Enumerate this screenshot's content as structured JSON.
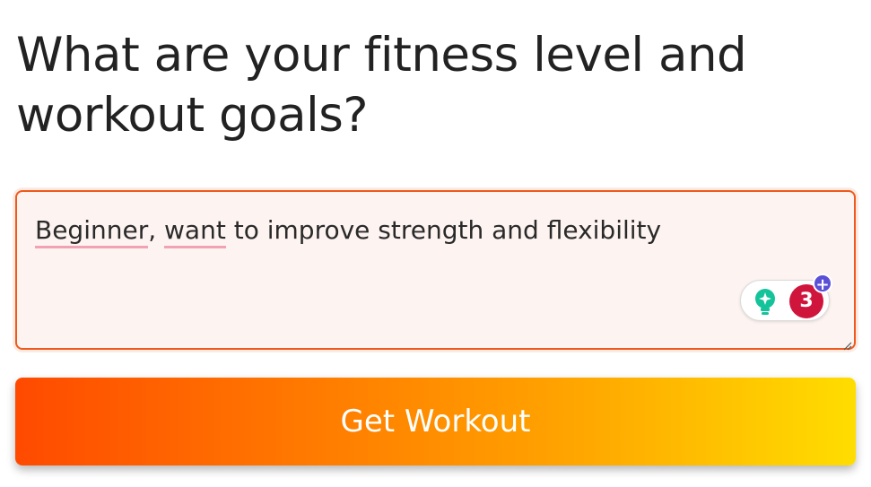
{
  "heading": {
    "text": "What are your fitness level and workout goals?"
  },
  "goals_input": {
    "value_parts": [
      "Beginner",
      ",",
      " ",
      "want",
      " to improve strength and flexibility"
    ],
    "value": "Beginner, want to improve strength and flexibility",
    "spell_flagged_words": [
      "Beginner",
      "want"
    ],
    "border_color": "#ee5a1c",
    "background_color": "#fdf3f1"
  },
  "grammarly": {
    "suggestion_count": "3",
    "plus_symbol": "+",
    "icons": [
      "lightbulb-icon",
      "plus-icon"
    ],
    "badge_color": "#d0153c",
    "bulb_color": "#15c39a",
    "plus_color": "#5a4fd6"
  },
  "cta": {
    "label": "Get Workout",
    "gradient_colors": [
      "#ff4a00",
      "#ff7a00",
      "#ffa300",
      "#ffdd00"
    ]
  }
}
